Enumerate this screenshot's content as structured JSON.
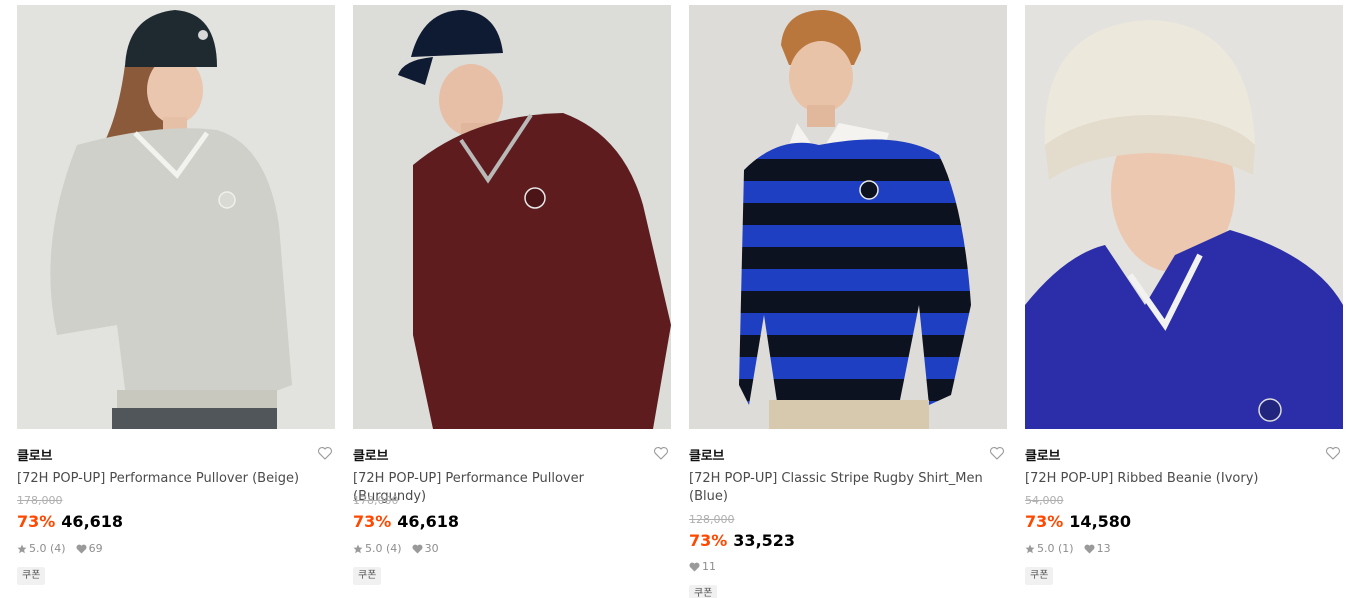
{
  "products": [
    {
      "brand": "클로브",
      "name": "[72H POP-UP] Performance Pullover (Beige)",
      "original_price": "178,000",
      "discount": "73%",
      "price": "46,618",
      "rating": "5.0",
      "review_count": "(4)",
      "likes": "69",
      "coupon": "쿠폰",
      "image_bg": "#e2e2df",
      "garment_color": "#cfd0ca"
    },
    {
      "brand": "클로브",
      "name": "[72H POP-UP] Performance Pullover (Burgundy)",
      "original_price": "178,000",
      "discount": "73%",
      "price": "46,618",
      "rating": "5.0",
      "review_count": "(4)",
      "likes": "30",
      "coupon": "쿠폰",
      "image_bg": "#dcdcd9",
      "garment_color": "#5e1c1f"
    },
    {
      "brand": "클로브",
      "name": "[72H POP-UP] Classic Stripe Rugby Shirt_Men (Blue)",
      "original_price": "128,000",
      "discount": "73%",
      "price": "33,523",
      "likes": "11",
      "coupon": "쿠폰",
      "image_bg": "#dedcd8",
      "garment_color": "#1e3fc2"
    },
    {
      "brand": "클로브",
      "name": "[72H POP-UP] Ribbed Beanie (Ivory)",
      "original_price": "54,000",
      "discount": "73%",
      "price": "14,580",
      "rating": "5.0",
      "review_count": "(1)",
      "likes": "13",
      "coupon": "쿠폰",
      "image_bg": "#e3e2de",
      "garment_color": "#ece8dc"
    }
  ],
  "colors": {
    "discount": "#ff4800",
    "muted": "#8e8e8e",
    "strike": "#b0b0b0"
  },
  "icons": {
    "wishlist": "heart-outline-icon",
    "rating": "star-icon",
    "likes": "heart-filled-icon"
  }
}
